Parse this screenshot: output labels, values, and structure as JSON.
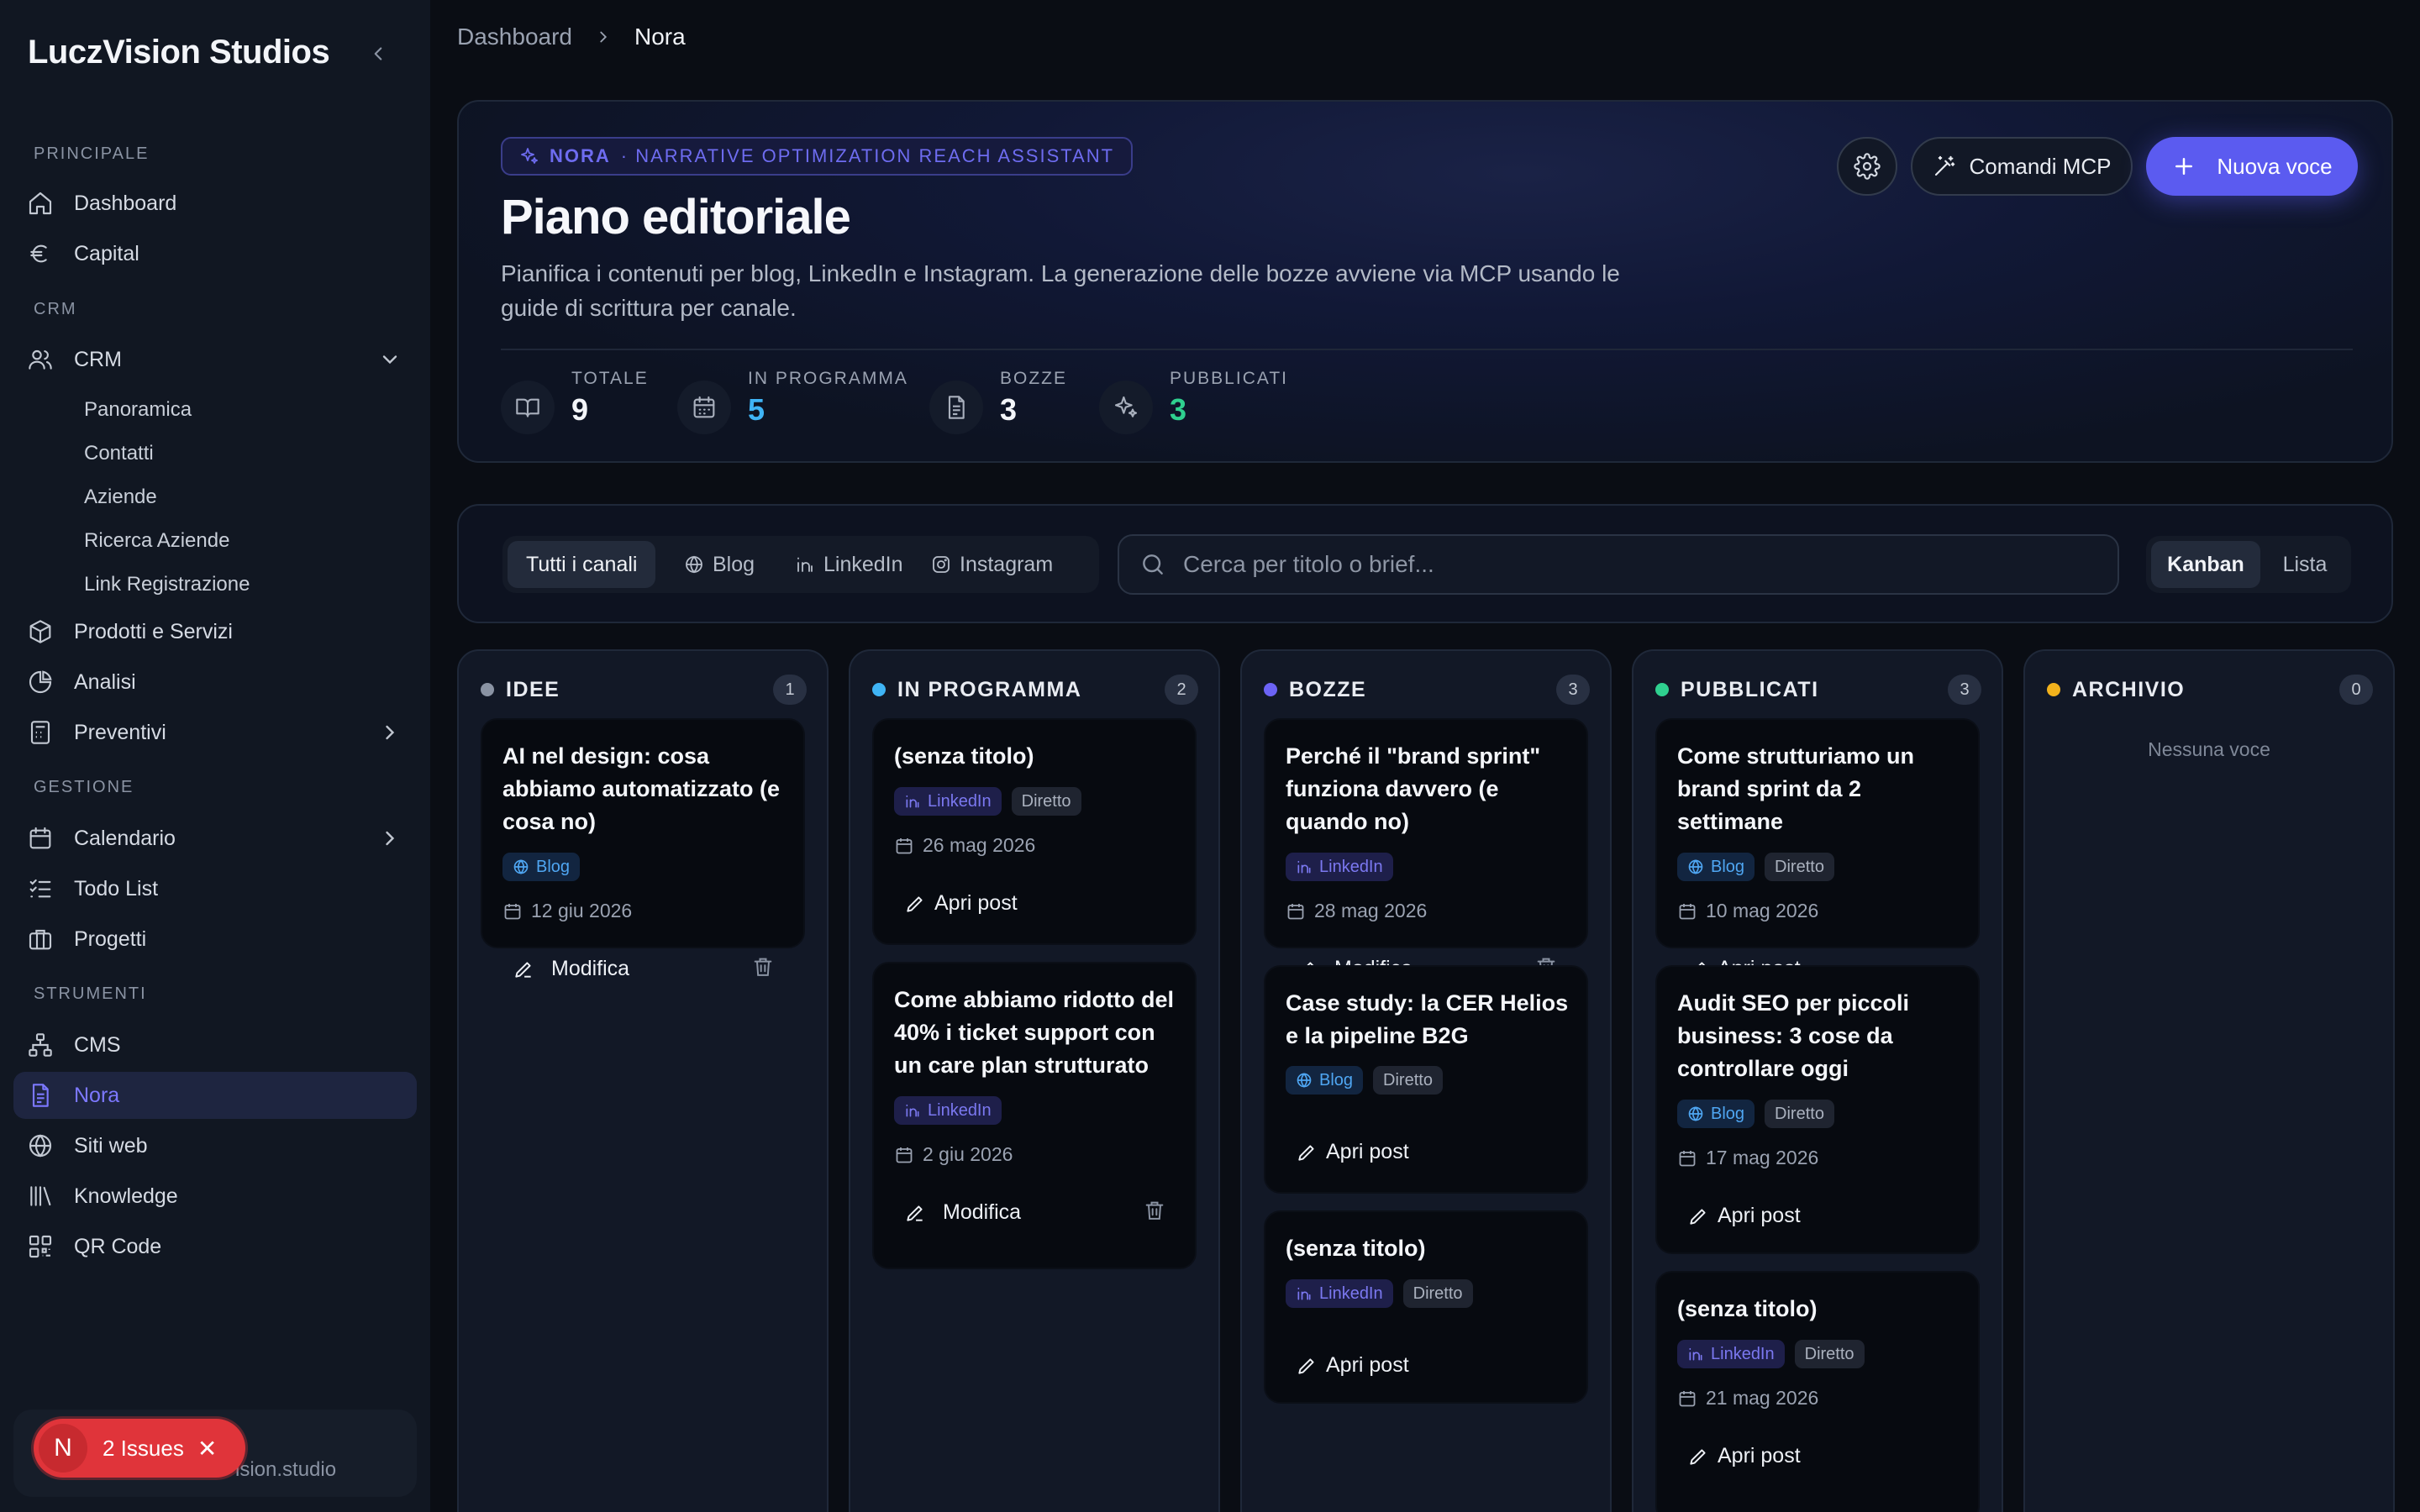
{
  "sidebar": {
    "brand": "LuczVision Studios",
    "sections": {
      "principale": "PRINCIPALE",
      "crm": "CRM",
      "gestione": "GESTIONE",
      "strumenti": "STRUMENTI"
    },
    "items": {
      "dashboard": "Dashboard",
      "capital": "Capital",
      "crm": "CRM",
      "prodotti": "Prodotti e Servizi",
      "analisi": "Analisi",
      "preventivi": "Preventivi",
      "calendario": "Calendario",
      "todo": "Todo List",
      "progetti": "Progetti",
      "cms": "CMS",
      "nora": "Nora",
      "siti": "Siti web",
      "knowledge": "Knowledge",
      "qr": "QR Code"
    },
    "crm_sub": {
      "panoramica": "Panoramica",
      "contatti": "Contatti",
      "aziende": "Aziende",
      "ricerca": "Ricerca Aziende",
      "link": "Link Registrazione"
    },
    "user_email_partial": "ision.studio",
    "issues": {
      "initial": "N",
      "label": "2 Issues"
    }
  },
  "breadcrumb": {
    "parent": "Dashboard",
    "current": "Nora"
  },
  "hero": {
    "badge_name": "NORA",
    "badge_sub": "· NARRATIVE OPTIMIZATION REACH ASSISTANT",
    "title": "Piano editoriale",
    "description": "Pianifica i contenuti per blog, LinkedIn e Instagram. La generazione delle bozze avviene via MCP usando le guide di scrittura per canale.",
    "buttons": {
      "mcp": "Comandi MCP",
      "new": "Nuova voce"
    },
    "stats": {
      "totale": {
        "label": "TOTALE",
        "value": "9",
        "color": "#f3f5f9"
      },
      "programma": {
        "label": "IN PROGRAMMA",
        "value": "5",
        "color": "#3fb4f5"
      },
      "bozze": {
        "label": "BOZZE",
        "value": "3",
        "color": "#f3f5f9"
      },
      "pubblicati": {
        "label": "PUBBLICATI",
        "value": "3",
        "color": "#2fd08f"
      }
    }
  },
  "filters": {
    "channels": {
      "all": "Tutti i canali",
      "blog": "Blog",
      "linkedin": "LinkedIn",
      "instagram": "Instagram"
    },
    "search_placeholder": "Cerca per titolo o brief...",
    "views": {
      "kanban": "Kanban",
      "lista": "Lista"
    }
  },
  "kanban": {
    "idee": {
      "title": "IDEE",
      "count": "1",
      "dot": "#8a93a3",
      "cards": [
        {
          "title": "AI nel design: cosa abbiamo automatizzato (e cosa no)",
          "tag": "Blog",
          "date": "12 giu 2026",
          "action": "Modifica"
        }
      ]
    },
    "programma": {
      "title": "IN PROGRAMMA",
      "count": "2",
      "dot": "#3fb4f5",
      "cards": [
        {
          "title": "(senza titolo)",
          "tag": "LinkedIn",
          "tag2": "Diretto",
          "date": "26 mag 2026",
          "action": "Apri post"
        },
        {
          "title": "Come abbiamo ridotto del 40% i ticket support con un care plan strutturato",
          "tag": "LinkedIn",
          "date": "2 giu 2026",
          "action": "Modifica"
        }
      ]
    },
    "bozze": {
      "title": "BOZZE",
      "count": "3",
      "dot": "#6c63f5",
      "cards": [
        {
          "title": "Perché il \"brand sprint\" funziona davvero (e quando no)",
          "tag": "LinkedIn",
          "date": "28 mag 2026",
          "action": "Modifica"
        },
        {
          "title": "Case study: la CER Helios e la pipeline B2G",
          "tag": "Blog",
          "tag2": "Diretto",
          "action": "Apri post"
        },
        {
          "title": "(senza titolo)",
          "tag": "LinkedIn",
          "tag2": "Diretto",
          "action": "Apri post"
        }
      ]
    },
    "pubblicati": {
      "title": "PUBBLICATI",
      "count": "3",
      "dot": "#2fd08f",
      "cards": [
        {
          "title": "Come strutturiamo un brand sprint da 2 settimane",
          "tag": "Blog",
          "tag2": "Diretto",
          "date": "10 mag 2026",
          "action": "Apri post"
        },
        {
          "title": "Audit SEO per piccoli business: 3 cose da controllare oggi",
          "tag": "Blog",
          "tag2": "Diretto",
          "date": "17 mag 2026",
          "action": "Apri post"
        },
        {
          "title": "(senza titolo)",
          "tag": "LinkedIn",
          "tag2": "Diretto",
          "date": "21 mag 2026",
          "action": "Apri post"
        }
      ]
    },
    "archivio": {
      "title": "ARCHIVIO",
      "count": "0",
      "dot": "#f2b21c",
      "empty": "Nessuna voce"
    }
  }
}
